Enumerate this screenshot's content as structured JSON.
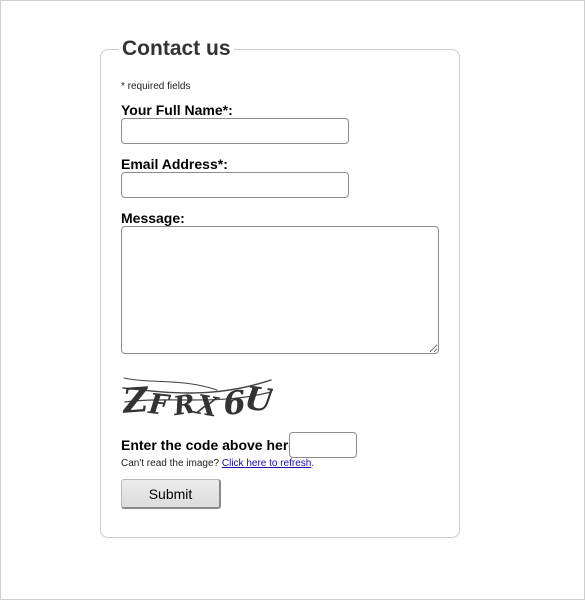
{
  "form": {
    "legend": "Contact us",
    "required_note": "* required fields",
    "fields": {
      "full_name": {
        "label": "Your Full Name*:",
        "value": ""
      },
      "email": {
        "label": "Email Address*:",
        "value": ""
      },
      "message": {
        "label": "Message:",
        "value": ""
      }
    },
    "captcha": {
      "image_text": "ZFRX6U",
      "label": "Enter the code above here:",
      "value": "",
      "refresh_prefix": "Can't read the image?",
      "refresh_link": "Click here to refresh",
      "refresh_suffix": "."
    },
    "submit_label": "Submit"
  },
  "colors": {
    "legend_text": "#333333",
    "fieldset_border": "#cccccc",
    "link": "#1a0dab",
    "captcha_ink": "#444444"
  }
}
